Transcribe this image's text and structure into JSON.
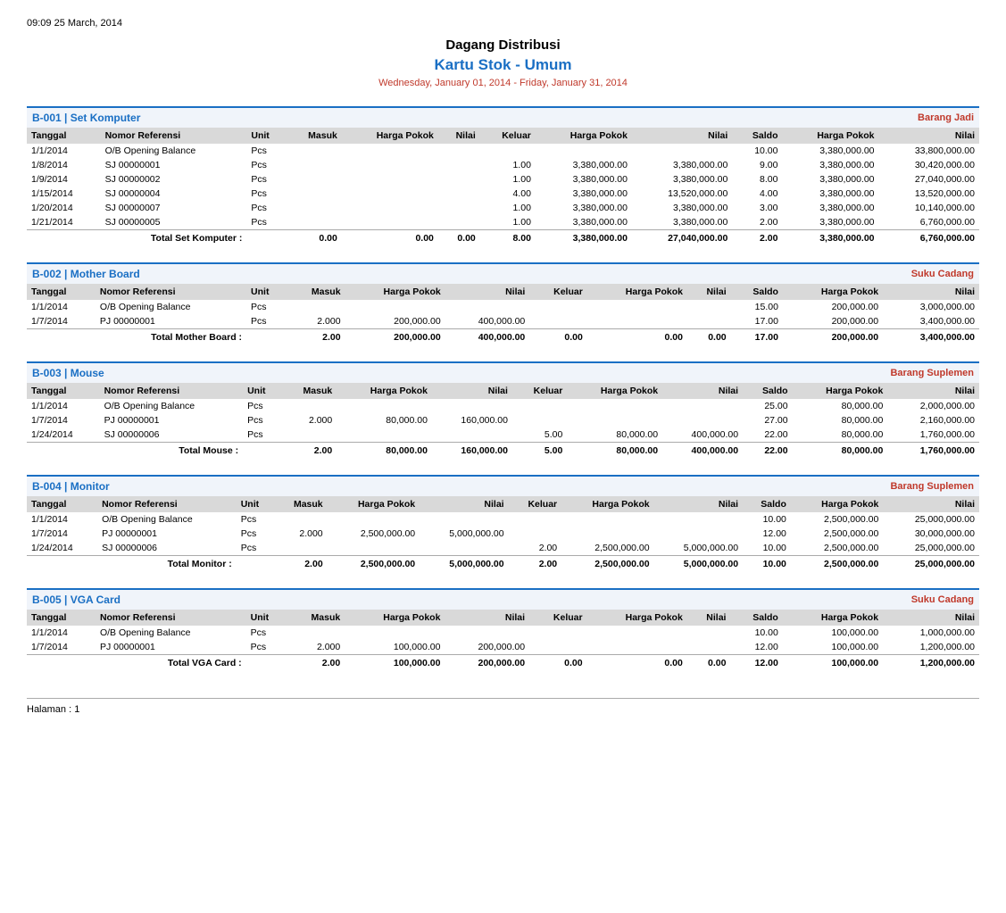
{
  "timestamp": "09:09   25 March, 2014",
  "title": "Dagang Distribusi",
  "subtitle": "Kartu Stok - Umum",
  "date_range": "Wednesday, January 01, 2014 - Friday, January 31, 2014",
  "sections": [
    {
      "code": "B-001",
      "name": "Set Komputer",
      "type": "Barang Jadi",
      "columns": [
        "Tanggal",
        "Nomor Referensi",
        "Unit",
        "Masuk",
        "Harga Pokok",
        "Nilai",
        "Keluar",
        "Harga Pokok",
        "Nilai",
        "Saldo",
        "Harga Pokok",
        "Nilai"
      ],
      "rows": [
        [
          "1/1/2014",
          "O/B",
          "Opening Balance",
          "Pcs",
          "",
          "",
          "",
          "",
          "",
          "",
          "10.00",
          "3,380,000.00",
          "33,800,000.00"
        ],
        [
          "1/8/2014",
          "SJ",
          "00000001",
          "Pcs",
          "",
          "",
          "",
          "1.00",
          "3,380,000.00",
          "3,380,000.00",
          "9.00",
          "3,380,000.00",
          "30,420,000.00"
        ],
        [
          "1/9/2014",
          "SJ",
          "00000002",
          "Pcs",
          "",
          "",
          "",
          "1.00",
          "3,380,000.00",
          "3,380,000.00",
          "8.00",
          "3,380,000.00",
          "27,040,000.00"
        ],
        [
          "1/15/2014",
          "SJ",
          "00000004",
          "Pcs",
          "",
          "",
          "",
          "4.00",
          "3,380,000.00",
          "13,520,000.00",
          "4.00",
          "3,380,000.00",
          "13,520,000.00"
        ],
        [
          "1/20/2014",
          "SJ",
          "00000007",
          "Pcs",
          "",
          "",
          "",
          "1.00",
          "3,380,000.00",
          "3,380,000.00",
          "3.00",
          "3,380,000.00",
          "10,140,000.00"
        ],
        [
          "1/21/2014",
          "SJ",
          "00000005",
          "Pcs",
          "",
          "",
          "",
          "1.00",
          "3,380,000.00",
          "3,380,000.00",
          "2.00",
          "3,380,000.00",
          "6,760,000.00"
        ]
      ],
      "total_label": "Total Set Komputer :",
      "total": [
        "",
        "",
        "0.00",
        "0.00",
        "0.00",
        "8.00",
        "3,380,000.00",
        "27,040,000.00",
        "2.00",
        "3,380,000.00",
        "6,760,000.00"
      ]
    },
    {
      "code": "B-002",
      "name": "Mother Board",
      "type": "Suku Cadang",
      "columns": [
        "Tanggal",
        "Nomor Referensi",
        "Unit",
        "Masuk",
        "Harga Pokok",
        "Nilai",
        "Keluar",
        "Harga Pokok",
        "Nilai",
        "Saldo",
        "Harga Pokok",
        "Nilai"
      ],
      "rows": [
        [
          "1/1/2014",
          "O/B",
          "Opening Balance",
          "Pcs",
          "",
          "",
          "",
          "",
          "",
          "",
          "15.00",
          "200,000.00",
          "3,000,000.00"
        ],
        [
          "1/7/2014",
          "PJ",
          "00000001",
          "Pcs",
          "2.000",
          "200,000.00",
          "400,000.00",
          "",
          "",
          "",
          "17.00",
          "200,000.00",
          "3,400,000.00"
        ]
      ],
      "total_label": "Total Mother Board :",
      "total": [
        "",
        "",
        "2.00",
        "200,000.00",
        "400,000.00",
        "0.00",
        "0.00",
        "0.00",
        "17.00",
        "200,000.00",
        "3,400,000.00"
      ]
    },
    {
      "code": "B-003",
      "name": "Mouse",
      "type": "Barang Suplemen",
      "columns": [
        "Tanggal",
        "Nomor Referensi",
        "Unit",
        "Masuk",
        "Harga Pokok",
        "Nilai",
        "Keluar",
        "Harga Pokok",
        "Nilai",
        "Saldo",
        "Harga Pokok",
        "Nilai"
      ],
      "rows": [
        [
          "1/1/2014",
          "O/B",
          "Opening Balance",
          "Pcs",
          "",
          "",
          "",
          "",
          "",
          "",
          "25.00",
          "80,000.00",
          "2,000,000.00"
        ],
        [
          "1/7/2014",
          "PJ",
          "00000001",
          "Pcs",
          "2.000",
          "80,000.00",
          "160,000.00",
          "",
          "",
          "",
          "27.00",
          "80,000.00",
          "2,160,000.00"
        ],
        [
          "1/24/2014",
          "SJ",
          "00000006",
          "Pcs",
          "",
          "",
          "",
          "5.00",
          "80,000.00",
          "400,000.00",
          "22.00",
          "80,000.00",
          "1,760,000.00"
        ]
      ],
      "total_label": "Total Mouse :",
      "total": [
        "",
        "",
        "2.00",
        "80,000.00",
        "160,000.00",
        "5.00",
        "80,000.00",
        "400,000.00",
        "22.00",
        "80,000.00",
        "1,760,000.00"
      ]
    },
    {
      "code": "B-004",
      "name": "Monitor",
      "type": "Barang Suplemen",
      "columns": [
        "Tanggal",
        "Nomor Referensi",
        "Unit",
        "Masuk",
        "Harga Pokok",
        "Nilai",
        "Keluar",
        "Harga Pokok",
        "Nilai",
        "Saldo",
        "Harga Pokok",
        "Nilai"
      ],
      "rows": [
        [
          "1/1/2014",
          "O/B",
          "Opening Balance",
          "Pcs",
          "",
          "",
          "",
          "",
          "",
          "",
          "10.00",
          "2,500,000.00",
          "25,000,000.00"
        ],
        [
          "1/7/2014",
          "PJ",
          "00000001",
          "Pcs",
          "2.000",
          "2,500,000.00",
          "5,000,000.00",
          "",
          "",
          "",
          "12.00",
          "2,500,000.00",
          "30,000,000.00"
        ],
        [
          "1/24/2014",
          "SJ",
          "00000006",
          "Pcs",
          "",
          "",
          "",
          "2.00",
          "2,500,000.00",
          "5,000,000.00",
          "10.00",
          "2,500,000.00",
          "25,000,000.00"
        ]
      ],
      "total_label": "Total Monitor :",
      "total": [
        "",
        "",
        "2.00",
        "2,500,000.00",
        "5,000,000.00",
        "2.00",
        "2,500,000.00",
        "5,000,000.00",
        "10.00",
        "2,500,000.00",
        "25,000,000.00"
      ]
    },
    {
      "code": "B-005",
      "name": "VGA Card",
      "type": "Suku Cadang",
      "columns": [
        "Tanggal",
        "Nomor Referensi",
        "Unit",
        "Masuk",
        "Harga Pokok",
        "Nilai",
        "Keluar",
        "Harga Pokok",
        "Nilai",
        "Saldo",
        "Harga Pokok",
        "Nilai"
      ],
      "rows": [
        [
          "1/1/2014",
          "O/B",
          "Opening Balance",
          "Pcs",
          "",
          "",
          "",
          "",
          "",
          "",
          "10.00",
          "100,000.00",
          "1,000,000.00"
        ],
        [
          "1/7/2014",
          "PJ",
          "00000001",
          "Pcs",
          "2.000",
          "100,000.00",
          "200,000.00",
          "",
          "",
          "",
          "12.00",
          "100,000.00",
          "1,200,000.00"
        ]
      ],
      "total_label": "Total VGA Card :",
      "total": [
        "",
        "",
        "2.00",
        "100,000.00",
        "200,000.00",
        "0.00",
        "0.00",
        "0.00",
        "12.00",
        "100,000.00",
        "1,200,000.00"
      ]
    }
  ],
  "footer": "Halaman : 1"
}
